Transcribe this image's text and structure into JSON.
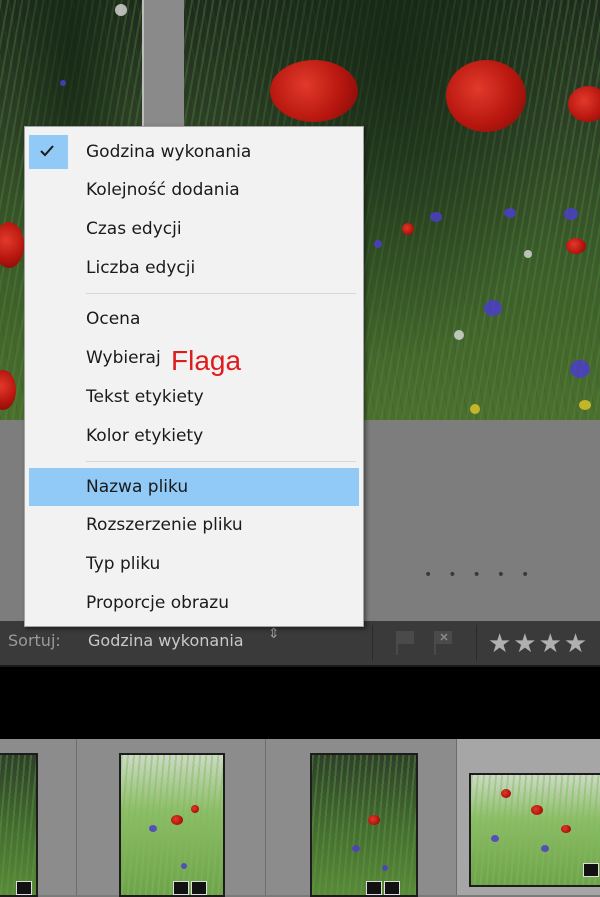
{
  "menu": {
    "items": [
      {
        "label": "Godzina wykonania",
        "checked": true
      },
      {
        "label": "Kolejność dodania"
      },
      {
        "label": "Czas edycji"
      },
      {
        "label": "Liczba edycji"
      },
      {
        "label": "Ocena"
      },
      {
        "label": "Wybieraj"
      },
      {
        "label": "Tekst etykiety"
      },
      {
        "label": "Kolor etykiety"
      },
      {
        "label": "Nazwa pliku",
        "highlighted": true
      },
      {
        "label": "Rozszerzenie pliku"
      },
      {
        "label": "Typ pliku"
      },
      {
        "label": "Proporcje obrazu"
      }
    ],
    "annotation": "Flaga"
  },
  "toolbar": {
    "sort_label": "Sortuj:",
    "sort_value": "Godzina wykonania",
    "sort_arrows": "⇕",
    "stars": "★★★★"
  },
  "colors": {
    "menu_bg": "#f2f2f2",
    "highlight": "#91c9f7",
    "annotation": "#e01b1b",
    "toolbar_bg": "#3a3a3a"
  }
}
